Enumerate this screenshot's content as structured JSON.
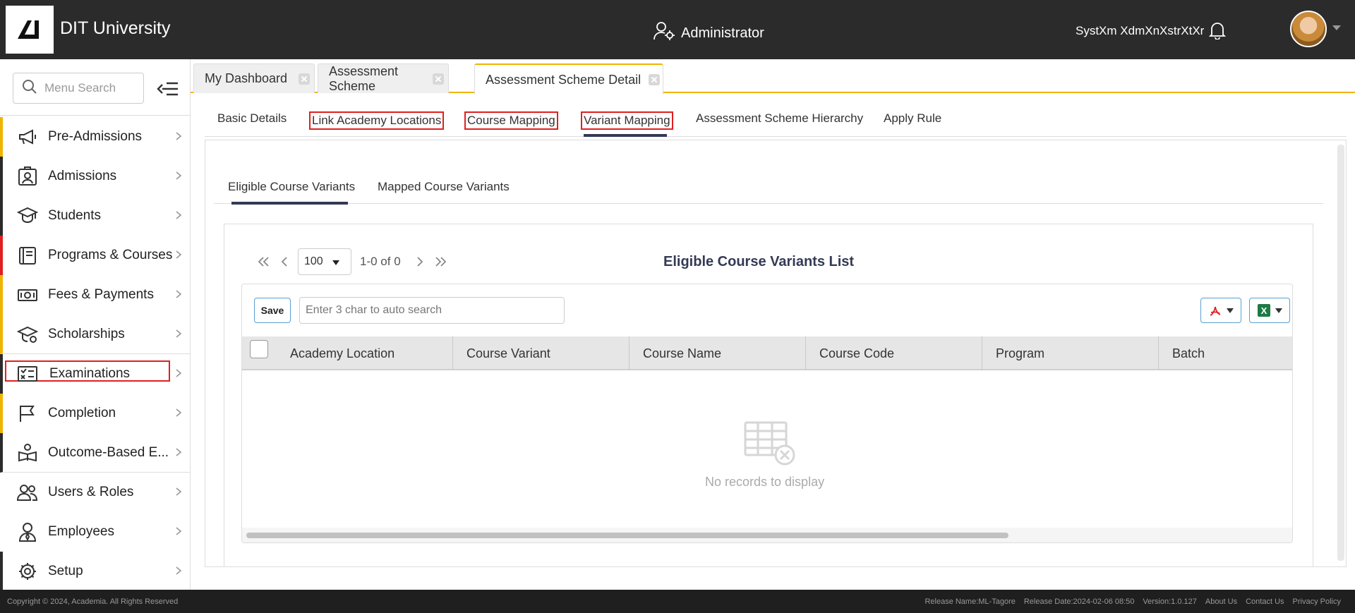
{
  "header": {
    "app_title": "DIT University",
    "role": "Administrator",
    "user_name": "SystXm XdmXnXstrXtXr"
  },
  "sidebar": {
    "search_placeholder": "Menu Search",
    "items": [
      {
        "label": "Pre-Admissions",
        "icon": "megaphone-icon",
        "accent": "#f0b400"
      },
      {
        "label": "Admissions",
        "icon": "id-card-icon",
        "accent": "#2b2b2b"
      },
      {
        "label": "Students",
        "icon": "graduation-cap-icon",
        "accent": "#2b2b2b"
      },
      {
        "label": "Programs & Courses",
        "icon": "book-icon",
        "accent": "#e02020"
      },
      {
        "label": "Fees & Payments",
        "icon": "money-icon",
        "accent": "#f0b400"
      },
      {
        "label": "Scholarships",
        "icon": "scholarship-icon",
        "accent": "#f0b400"
      },
      {
        "label": "Examinations",
        "icon": "exam-icon",
        "accent": "#2b2b2b"
      },
      {
        "label": "Completion",
        "icon": "flag-icon",
        "accent": "#f0b400"
      },
      {
        "label": "Outcome-Based E...",
        "icon": "open-book-icon",
        "accent": "#2b2b2b"
      },
      {
        "label": "Users & Roles",
        "icon": "users-icon",
        "accent": "#ffffff"
      },
      {
        "label": "Employees",
        "icon": "employee-icon",
        "accent": "#ffffff"
      },
      {
        "label": "Setup",
        "icon": "gear-icon",
        "accent": "#2b2b2b"
      }
    ]
  },
  "tabs": [
    {
      "label": "My Dashboard"
    },
    {
      "label": "Assessment Scheme"
    },
    {
      "label": "Assessment Scheme Detail"
    }
  ],
  "subnav": {
    "items": [
      "Basic Details",
      "Link Academy Locations",
      "Course Mapping",
      "Variant Mapping",
      "Assessment Scheme Hierarchy",
      "Apply Rule"
    ]
  },
  "inner_tabs": [
    "Eligible Course Variants",
    "Mapped Course Variants"
  ],
  "grid": {
    "page_size": "100",
    "page_info": "1-0 of 0",
    "title": "Eligible Course Variants List",
    "save_label": "Save",
    "search_placeholder": "Enter 3 char to auto search",
    "columns": [
      "Academy Location",
      "Course Variant",
      "Course Name",
      "Course Code",
      "Program",
      "Batch"
    ],
    "empty_text": "No records to display"
  },
  "footer": {
    "copyright": "Copyright © 2024, Academia. All Rights Reserved",
    "release_name": "Release Name:ML-Tagore",
    "release_date": "Release Date:2024-02-06 08:50",
    "version": "Version:1.0.127",
    "about": "About Us",
    "contact": "Contact Us",
    "privacy": "Privacy Policy"
  }
}
